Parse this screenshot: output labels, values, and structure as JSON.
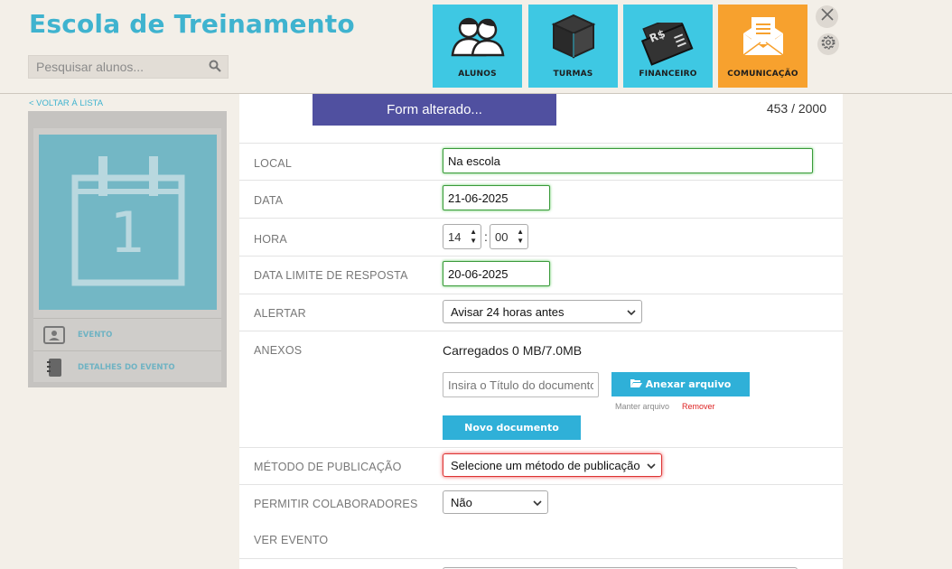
{
  "app": {
    "title": "Escola de Treinamento"
  },
  "search": {
    "placeholder": "Pesquisar alunos..."
  },
  "nav": [
    {
      "label": "ALUNOS",
      "icon": "students-icon"
    },
    {
      "label": "TURMAS",
      "icon": "box-icon"
    },
    {
      "label": "FINANCEIRO",
      "icon": "money-icon",
      "currency": "R$"
    },
    {
      "label": "COMUNICAÇÃO",
      "icon": "envelope-icon",
      "active": true
    }
  ],
  "sidebar": {
    "back_label": "< VOLTAR À LISTA",
    "calendar_day": "1",
    "items": [
      {
        "label": "EVENTO",
        "icon": "contact-card-icon"
      },
      {
        "label": "DETALHES DO EVENTO",
        "icon": "notebook-icon"
      }
    ]
  },
  "form": {
    "status_button": "Form alterado...",
    "char_counter": "453 / 2000",
    "local": {
      "label": "LOCAL",
      "value": "Na escola"
    },
    "data": {
      "label": "DATA",
      "value": "21-06-2025"
    },
    "hora": {
      "label": "HORA",
      "hour": "14",
      "separator": ":",
      "minute": "00"
    },
    "data_limite": {
      "label": "DATA LIMITE DE RESPOSTA",
      "value": "20-06-2025"
    },
    "alertar": {
      "label": "ALERTAR",
      "value": "Avisar 24 horas antes"
    },
    "anexos": {
      "label": "ANEXOS",
      "loaded": "Carregados 0 MB/7.0MB",
      "title_placeholder": "Insira o Título do documento",
      "attach_button": "Anexar arquivo",
      "keep_file": "Manter arquivo",
      "remove": "Remover",
      "new_document_button": "Novo documento"
    },
    "metodo": {
      "label": "MÉTODO DE PUBLICAÇÃO",
      "value": "Selecione um método de publicação"
    },
    "colaboradores": {
      "label": "PERMITIR COLABORADORES",
      "value": "Não"
    },
    "ver_evento": {
      "label": "VER EVENTO"
    }
  },
  "colors": {
    "brand": "#3fb3cf",
    "tile": "#3ec8e3",
    "active_tile": "#f7a12e",
    "status_button": "#5050a0"
  }
}
